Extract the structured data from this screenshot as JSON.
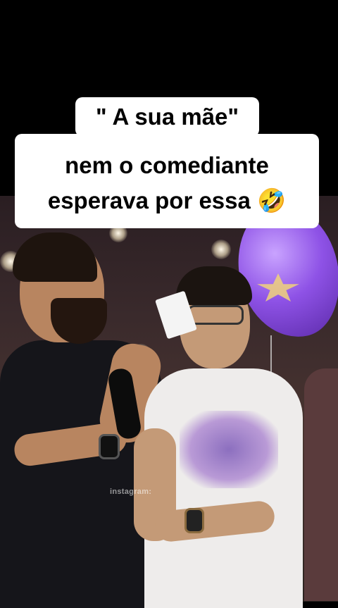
{
  "caption": {
    "line1": "\" A sua mãe\"",
    "line2": "nem o comediante",
    "line3": "esperava por essa 🤣"
  },
  "watermark": {
    "text": "instagram:"
  },
  "colors": {
    "background": "#000000",
    "caption_bg": "#ffffff",
    "caption_text": "#000000",
    "balloon": "#8e52e6"
  }
}
